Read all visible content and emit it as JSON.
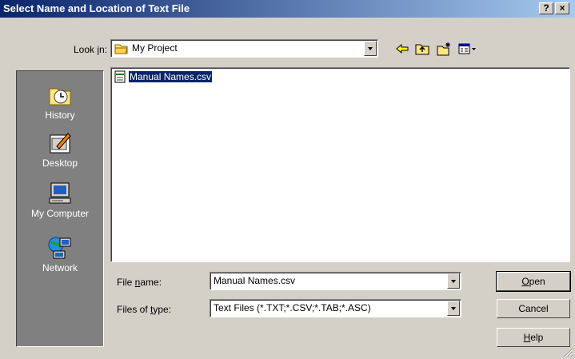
{
  "window": {
    "title": "Select Name and Location of Text File",
    "help_label": "?",
    "close_label": "×"
  },
  "lookin": {
    "label_pre": "Look ",
    "label_key": "i",
    "label_post": "n:",
    "value": "My Project"
  },
  "toolbar": {
    "icons": [
      "back-arrow-icon",
      "up-one-level-icon",
      "create-new-folder-icon",
      "view-menu-icon"
    ]
  },
  "places": [
    {
      "label": "History",
      "icon": "history-icon"
    },
    {
      "label": "Desktop",
      "icon": "desktop-icon"
    },
    {
      "label": "My Computer",
      "icon": "my-computer-icon"
    },
    {
      "label": "Network",
      "icon": "network-icon"
    }
  ],
  "files": [
    {
      "name": "Manual Names.csv",
      "icon": "csv-file-icon",
      "selected": true
    }
  ],
  "filename": {
    "label_pre": "File ",
    "label_key": "n",
    "label_post": "ame:",
    "value": "Manual Names.csv"
  },
  "filetype": {
    "label_pre": "Files of ",
    "label_key": "t",
    "label_post": "ype:",
    "value": "Text Files (*.TXT;*.CSV;*.TAB;*.ASC)"
  },
  "buttons": {
    "open_key": "O",
    "open_rest": "pen",
    "cancel": "Cancel",
    "help_key": "H",
    "help_rest": "elp"
  },
  "colors": {
    "title_start": "#0a246a",
    "title_end": "#a6caf0",
    "face": "#d4d0c8",
    "places_bg": "#808080",
    "selection": "#0a246a"
  }
}
